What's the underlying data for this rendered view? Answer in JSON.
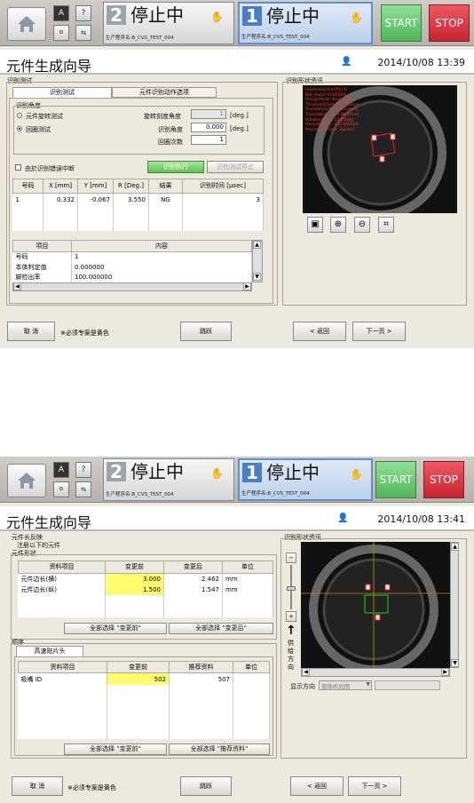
{
  "top": {
    "home_icon": "home-icon",
    "key_a_icon": "keyboard-a-icon",
    "help_icon": "question-icon",
    "small_icon_1": "machine-icon",
    "small_icon_2": "transfer-icon",
    "station2": {
      "num": "2",
      "status": "停止中",
      "program": "生产程序名:B_CVS_TEST_004"
    },
    "station1": {
      "num": "1",
      "status": "停止中",
      "program": "生产程序名:B_CVS_TEST_004"
    },
    "start": "START",
    "stop": "STOP"
  },
  "screen1": {
    "title": "元件生成向导",
    "datetime": "2014/10/08 13:39",
    "left_group": "识别测试",
    "tabs": [
      "识别测试",
      "元件识别动作选项"
    ],
    "angle_group": "识别角度",
    "radio1": "元件旋转测试",
    "radio2": "回圈测试",
    "rot_label": "旋转刻度角度",
    "rot_value": "1",
    "rot_unit": "[deg.]",
    "angle_label": "识别角度",
    "angle_value": "0.000",
    "angle_unit": "[deg.]",
    "loop_label": "回圈次数",
    "loop_value": "1",
    "chk_label": "由於识别错误中断",
    "exec_btn": "识别执行",
    "stop_btn": "识别测试停止",
    "result_headers": [
      "号码",
      "X [mm]",
      "Y [mm]",
      "R [Deg.]",
      "结果",
      "识别时间 [µsec]"
    ],
    "result_row": [
      "1",
      "0.332",
      "-0.067",
      "3.550",
      "NG",
      "3"
    ],
    "detail_headers": [
      "项目",
      "内容"
    ],
    "detail_rows": [
      [
        "号码",
        "1"
      ],
      [
        "本体判定值",
        "0.000000"
      ],
      [
        "脚检出率",
        "100.000000"
      ]
    ],
    "right_group": "识别形状资讯",
    "overlay_lines": [
      "Leadeselecterr[P1/3]",
      "Not match 0.000000",
      "Recog.Mode: BodyCenter",
      "Threshold(Sel):(P1)Position",
      "Translation[X]: 0.332[mm]",
      "Translation[Y]: -0.067[mm]",
      "Rotation[R]: 3.550[Deg]",
      "Passrate(Sel): 100.000000",
      "ProcessingTime: 3[µsec]"
    ],
    "tools": [
      "image-icon",
      "zoom-in-icon",
      "zoom-out-icon",
      "fit-icon"
    ],
    "cancel": "取 消",
    "note": "※必须专案是黄色",
    "skip": "跳跃",
    "back": "< 返回",
    "next": "下一页 >"
  },
  "screen2": {
    "title": "元件生成向导",
    "datetime": "2014/10/08 13:41",
    "fb_group": "元件长反映",
    "fb_note": "注册以下的元件",
    "shape_group": "元件形状",
    "shape_headers": [
      "资料项目",
      "变更前",
      "变更后",
      "单位"
    ],
    "shape_rows": [
      [
        "元件边长(横)",
        "3.000",
        "2.462",
        "mm"
      ],
      [
        "元件边长(纵)",
        "1.500",
        "1.547",
        "mm"
      ]
    ],
    "sel_before": "全部选择 \"变更前\"",
    "sel_after": "全部选择 \"变更后\"",
    "order_group": "顺序",
    "order_tab": "高速贴片头",
    "order_headers": [
      "资料项目",
      "变更前",
      "推荐资料",
      "单位"
    ],
    "order_rows": [
      [
        "吸嘴 ID",
        "502",
        "507",
        ""
      ]
    ],
    "sel_before2": "全部选择 \"变更前\"",
    "sel_rec": "全部选择 \"推荐资料\"",
    "right_group": "识别形状资讯",
    "feed_label": "供\n给\n方\n向",
    "display_dir_label": "显示方向",
    "display_dir_value": "摄像机视图",
    "cancel": "取 消",
    "note": "※必须专案是黄色",
    "skip": "跳跃",
    "back": "< 返回",
    "next": "下一页 >"
  }
}
